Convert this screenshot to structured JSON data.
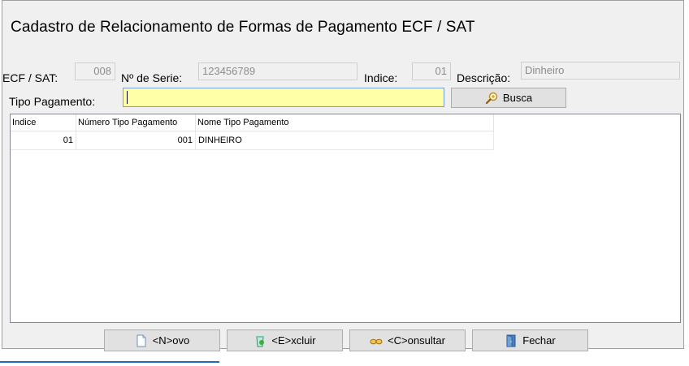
{
  "window": {
    "title": "Cadastro de Relacionamento de Formas de Pagamento ECF / SAT"
  },
  "fields": {
    "ecf_label": "ECF / SAT:",
    "ecf_value": "008",
    "serie_label": "Nº de Serie:",
    "serie_value": "123456789",
    "indice_label": "Indice:",
    "indice_value": "01",
    "descricao_label": "Descrição:",
    "descricao_value": "Dinheiro",
    "tipo_label": "Tipo Pagamento:",
    "tipo_value": ""
  },
  "buttons": {
    "busca": "Busca",
    "novo": "<N>ovo",
    "excluir": "<E>xcluir",
    "consultar": "<C>onsultar",
    "fechar": "Fechar"
  },
  "grid": {
    "columns": [
      "Indice",
      "Número Tipo Pagamento",
      "Nome Tipo Pagamento"
    ],
    "rows": [
      {
        "indice": "01",
        "numero": "001",
        "nome": "DINHEIRO"
      }
    ]
  },
  "colors": {
    "input_highlight": "#ffffa8",
    "window_bg": "#f0f0f0"
  },
  "icons": {
    "busca": "magnifier-icon",
    "novo": "new-document-icon",
    "excluir": "delete-icon",
    "consultar": "glasses-icon",
    "fechar": "exit-door-icon"
  }
}
